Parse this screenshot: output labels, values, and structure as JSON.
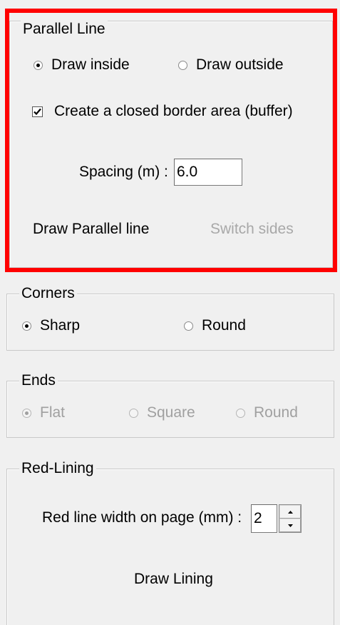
{
  "parallel_line": {
    "title": "Parallel Line",
    "options": {
      "draw_inside": "Draw inside",
      "draw_outside": "Draw outside",
      "selected": "draw_inside"
    },
    "closed_border": {
      "label": "Create a closed border area (buffer)",
      "checked": true
    },
    "spacing": {
      "label": "Spacing (m) :",
      "value": "6.0"
    },
    "draw_button": "Draw Parallel line",
    "switch_sides_button": "Switch sides"
  },
  "corners": {
    "title": "Corners",
    "sharp": "Sharp",
    "round": "Round",
    "selected": "sharp"
  },
  "ends": {
    "title": "Ends",
    "flat": "Flat",
    "square": "Square",
    "round": "Round",
    "selected": "flat",
    "enabled": false
  },
  "red_lining": {
    "title": "Red-Lining",
    "width_label": "Red line width on page (mm) :",
    "width_value": "2",
    "draw_button": "Draw Lining"
  },
  "colors": {
    "highlight": "#ff0000",
    "background": "#f0f0f0",
    "disabled_text": "#a0a0a0"
  }
}
